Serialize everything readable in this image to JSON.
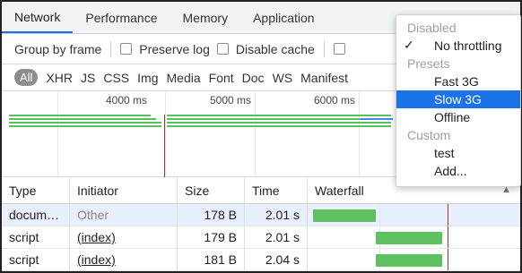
{
  "tabs": [
    {
      "label": "Network",
      "active": true
    },
    {
      "label": "Performance",
      "active": false
    },
    {
      "label": "Memory",
      "active": false
    },
    {
      "label": "Application",
      "active": false
    }
  ],
  "toolbar": {
    "group_by_frame": "Group by frame",
    "preserve_log": "Preserve log",
    "disable_cache": "Disable cache"
  },
  "filters": [
    "All",
    "XHR",
    "JS",
    "CSS",
    "Img",
    "Media",
    "Font",
    "Doc",
    "WS",
    "Manifest"
  ],
  "overview": {
    "ticks": [
      "4000 ms",
      "5000 ms",
      "6000 ms"
    ]
  },
  "table": {
    "columns": [
      "Type",
      "Initiator",
      "Size",
      "Time",
      "Waterfall"
    ],
    "rows": [
      {
        "type": "docum…",
        "initiator": "Other",
        "size": "178 B",
        "time": "2.01 s",
        "selected": true
      },
      {
        "type": "script",
        "initiator": "(index)",
        "size": "179 B",
        "time": "2.01 s",
        "selected": false
      },
      {
        "type": "script",
        "initiator": "(index)",
        "size": "181 B",
        "time": "2.04 s",
        "selected": false
      }
    ]
  },
  "throttle_menu": {
    "items": [
      {
        "label": "Disabled",
        "kind": "group"
      },
      {
        "label": "No throttling",
        "kind": "item",
        "checked": true
      },
      {
        "label": "Presets",
        "kind": "group"
      },
      {
        "label": "Fast 3G",
        "kind": "item"
      },
      {
        "label": "Slow 3G",
        "kind": "item",
        "highlighted": true
      },
      {
        "label": "Offline",
        "kind": "item"
      },
      {
        "label": "Custom",
        "kind": "group"
      },
      {
        "label": "test",
        "kind": "item"
      },
      {
        "label": "Add...",
        "kind": "item"
      }
    ],
    "check_glyph": "✓"
  },
  "colors": {
    "accent": "#1a73e8",
    "bar_green": "#5ec05e",
    "marker_red": "#c62828"
  }
}
